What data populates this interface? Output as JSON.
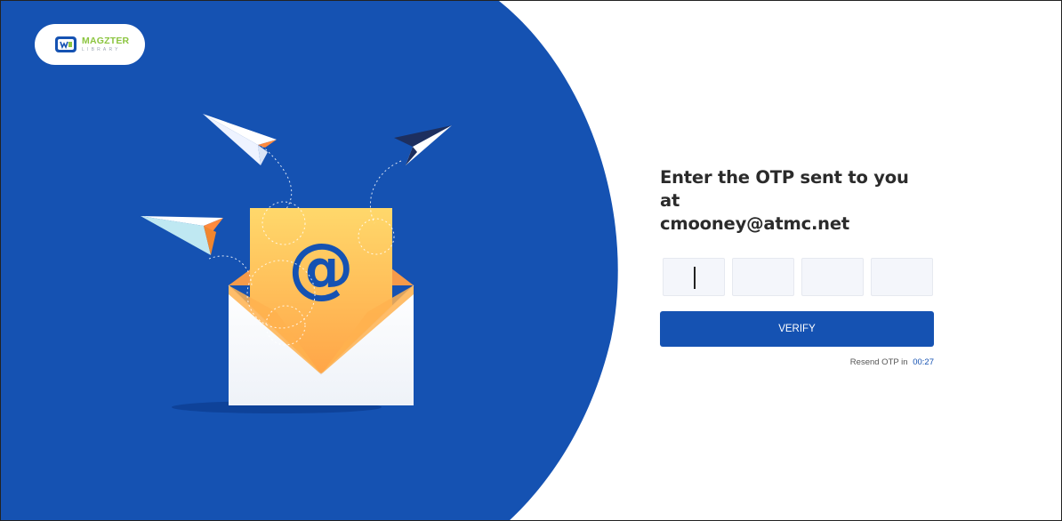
{
  "brand": {
    "name": "MAGZTER",
    "subtitle": "LIBRARY",
    "colors": {
      "primary_blue": "#1552b2",
      "logo_green": "#8cc540"
    }
  },
  "illustration": {
    "icon_names": [
      "envelope-icon",
      "at-sign-icon",
      "paper-plane-icon"
    ],
    "symbol": "@"
  },
  "otp": {
    "heading_line1": "Enter the OTP sent to you at",
    "email": "cmooney@atmc.net",
    "digits": [
      "",
      "",
      "",
      ""
    ],
    "verify_label": "VERIFY",
    "resend_label": "Resend OTP in",
    "resend_timer": "00:27"
  }
}
